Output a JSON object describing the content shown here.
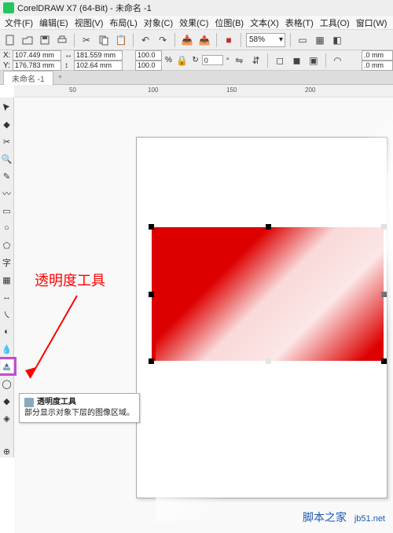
{
  "titlebar": {
    "title": "CorelDRAW X7 (64-Bit) - 未命名 -1"
  },
  "menu": {
    "file": "文件(F)",
    "edit": "编辑(E)",
    "view": "视图(V)",
    "layout": "布局(L)",
    "object": "对象(C)",
    "effect": "效果(C)",
    "bitmap": "位图(B)",
    "text": "文本(X)",
    "table": "表格(T)",
    "tool": "工具(O)",
    "window": "窗口(W)"
  },
  "toolbar": {
    "zoom": "58%"
  },
  "props": {
    "x_label": "X:",
    "y_label": "Y:",
    "x_val": "107.449 mm",
    "y_val": "176.783 mm",
    "w_val": "181.559 mm",
    "h_val": "102.64 mm",
    "sx": "100.0",
    "sy": "100.0",
    "rot_label": "↻",
    "rot": "0",
    "stroke_a": ".0 mm",
    "stroke_b": ".0 mm"
  },
  "tabs": {
    "doc": "未命名 -1",
    "plus": "+"
  },
  "ruler": {
    "t50": "50",
    "t100": "100",
    "t150": "150",
    "t200": "200"
  },
  "tooltip": {
    "title": "透明度工具",
    "desc": "部分显示对象下层的图像区域。"
  },
  "annotation": {
    "label": "透明度工具"
  },
  "watermark": {
    "brand": "脚本之家",
    "url": "jb51.net"
  }
}
